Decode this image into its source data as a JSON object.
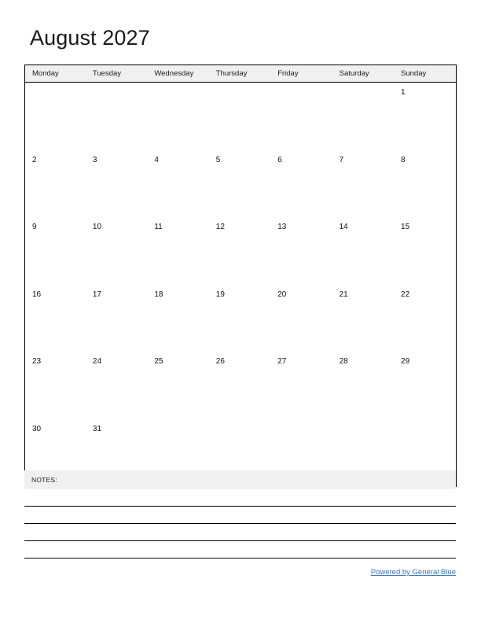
{
  "calendar": {
    "title": "August 2027",
    "month": "August",
    "year": "2027",
    "weekday_headers": [
      "Monday",
      "Tuesday",
      "Wednesday",
      "Thursday",
      "Friday",
      "Saturday",
      "Sunday"
    ],
    "weeks": [
      [
        "",
        "",
        "",
        "",
        "",
        "",
        "1"
      ],
      [
        "2",
        "3",
        "4",
        "5",
        "6",
        "7",
        "8"
      ],
      [
        "9",
        "10",
        "11",
        "12",
        "13",
        "14",
        "15"
      ],
      [
        "16",
        "17",
        "18",
        "19",
        "20",
        "21",
        "22"
      ],
      [
        "23",
        "24",
        "25",
        "26",
        "27",
        "28",
        "29"
      ],
      [
        "30",
        "31",
        "",
        "",
        "",
        "",
        ""
      ]
    ]
  },
  "notes": {
    "label": "NOTES:",
    "line_count": 4
  },
  "footer": {
    "link_text": "Powered by General Blue"
  },
  "colors": {
    "header_fill": "#f0f0f0",
    "border": "#000000",
    "link": "#3a76c4",
    "text": "#1a1a1a",
    "page_background": "#ffffff"
  }
}
